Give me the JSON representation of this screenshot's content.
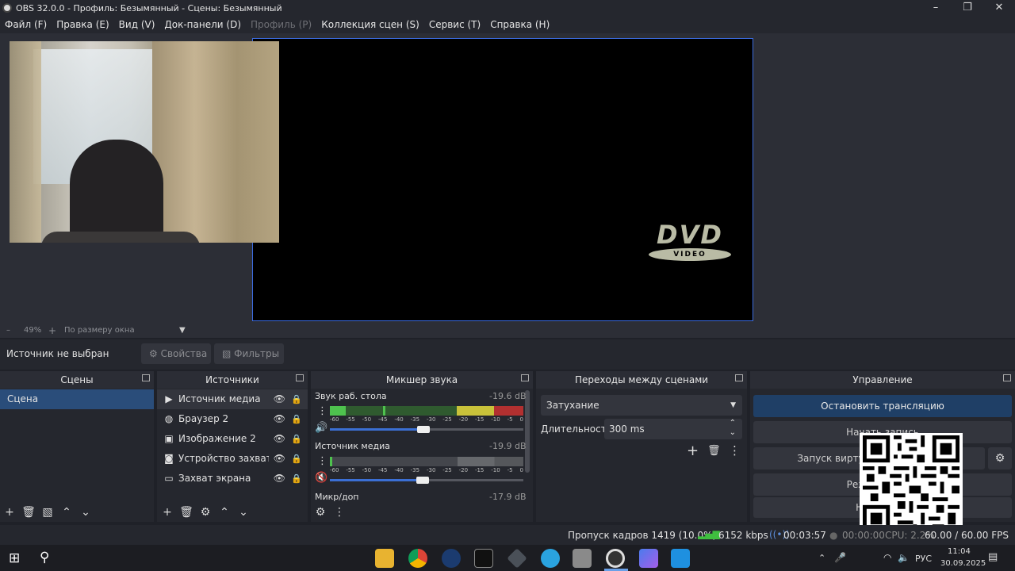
{
  "window": {
    "title": "OBS 32.0.0 - Профиль: Безымянный - Сцены: Безымянный"
  },
  "menu": [
    {
      "label": "Файл (F)",
      "disabled": false
    },
    {
      "label": "Правка (E)",
      "disabled": false
    },
    {
      "label": "Вид (V)",
      "disabled": false
    },
    {
      "label": "Док-панели (D)",
      "disabled": false
    },
    {
      "label": "Профиль (P)",
      "disabled": true
    },
    {
      "label": "Коллекция сцен (S)",
      "disabled": false
    },
    {
      "label": "Сервис (T)",
      "disabled": false
    },
    {
      "label": "Справка (H)",
      "disabled": false
    }
  ],
  "preview": {
    "dvd_logo_text": "DVD",
    "dvd_logo_sub": "VIDEO"
  },
  "zoom": {
    "minus": "–",
    "value": "49%",
    "plus": "+",
    "mode": "По размеру окна"
  },
  "source_bar": {
    "status": "Источник не выбран",
    "properties": "Свойства",
    "filters": "Фильтры"
  },
  "scenes": {
    "title": "Сцены",
    "items": [
      "Сцена"
    ]
  },
  "sources": {
    "title": "Источники",
    "items": [
      {
        "label": "Источник медиа",
        "icon": "play-icon"
      },
      {
        "label": "Браузер 2",
        "icon": "globe-icon"
      },
      {
        "label": "Изображение 2",
        "icon": "image-icon"
      },
      {
        "label": "Устройство захвата видео",
        "icon": "camera-icon"
      },
      {
        "label": "Захват экрана",
        "icon": "monitor-icon"
      }
    ]
  },
  "mixer": {
    "title": "Микшер звука",
    "ticks": [
      "-60",
      "-55",
      "-50",
      "-45",
      "-40",
      "-35",
      "-30",
      "-25",
      "-20",
      "-15",
      "-10",
      "-5",
      "0"
    ],
    "channels": [
      {
        "name": "Звук раб. стола",
        "db": "-19.6 dB",
        "level": 0.28,
        "fader": 0.48,
        "muted": false
      },
      {
        "name": "Источник медиа",
        "db": "-19.9 dB",
        "level": 0.0,
        "fader": 0.48,
        "muted": true
      },
      {
        "name": "Микр/доп",
        "db": "-17.9 dB",
        "level": 0.0,
        "fader": 0.48,
        "muted": false
      }
    ]
  },
  "transitions": {
    "title": "Переходы между сценами",
    "selected": "Затухание",
    "duration_label": "Длительность",
    "duration_value": "300 ms"
  },
  "controls": {
    "title": "Управление",
    "stop_stream": "Остановить трансляцию",
    "start_record": "Начать запись",
    "virtual_cam": "Запуск виртуальной камеры",
    "studio_mode": "Режим студии",
    "settings": "Настройки"
  },
  "status": {
    "dropped": "Пропуск кадров 1419 (10.0%)",
    "bitrate": "6152 kbps",
    "stream_time": "00:03:57",
    "rec_time": "00:00:00",
    "cpu": "CPU: 2.2%",
    "fps": "60.00 / 60.00 FPS"
  },
  "taskbar": {
    "lang": "РУС",
    "time": "11:04",
    "date": "30.09.2025"
  },
  "colors": {
    "accent": "#3c6ce0",
    "stream_button": "#1f3f66",
    "meter_green": "#4ec24e",
    "meter_yellow": "#c9c23a",
    "meter_red": "#b23030"
  }
}
